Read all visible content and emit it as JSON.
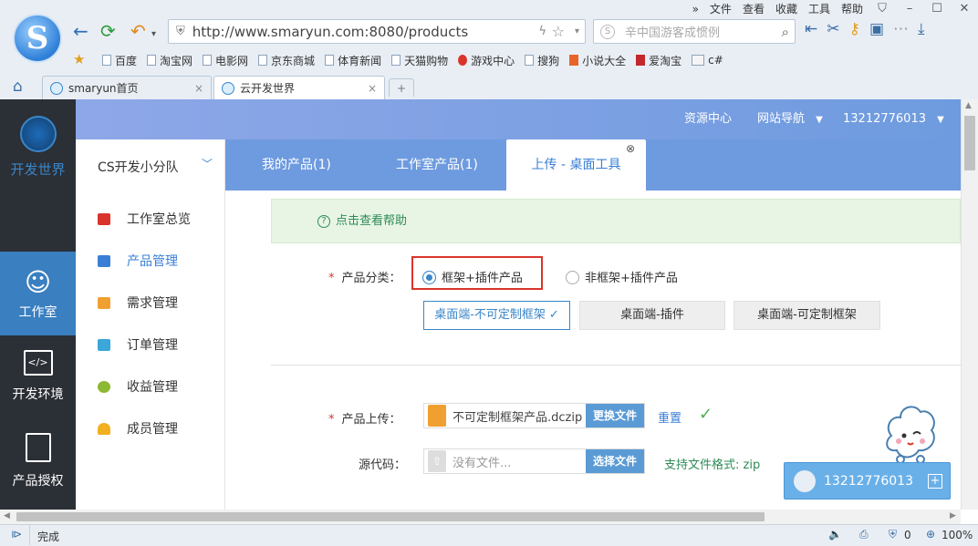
{
  "browser": {
    "menu": [
      "»",
      "文件",
      "查看",
      "收藏",
      "工具",
      "帮助"
    ],
    "url": "http://www.smaryun.com:8080/products",
    "search_placeholder": "辛中国游客成惯例",
    "logo_letter": "S",
    "bookmarks": [
      "百度",
      "淘宝网",
      "电影网",
      "京东商城",
      "体育新闻",
      "天猫购物",
      "游戏中心",
      "搜狗",
      "小说大全",
      "爱淘宝",
      "c#"
    ],
    "tabs": [
      {
        "label": "smaryun首页"
      },
      {
        "label": "云开发世界"
      }
    ],
    "tab_close": "×",
    "new_tab": "+",
    "status_text": "完成",
    "status_count": "0",
    "zoom": "100%"
  },
  "rail": {
    "brand": "开发世界",
    "items": [
      {
        "label": "工作室"
      },
      {
        "label": "开发环境"
      },
      {
        "label": "产品授权"
      }
    ]
  },
  "topbar": {
    "resource": "资源中心",
    "nav": "网站导航",
    "user": "13212776013"
  },
  "team": {
    "name": "CS开发小分队",
    "chevron": "﹀"
  },
  "sidebar": {
    "items": [
      {
        "label": "工作室总览",
        "color": "#d9342b"
      },
      {
        "label": "产品管理",
        "color": "#3a7fd5"
      },
      {
        "label": "需求管理",
        "color": "#f0a030"
      },
      {
        "label": "订单管理",
        "color": "#3aa7d8"
      },
      {
        "label": "收益管理",
        "color": "#8cb832"
      },
      {
        "label": "成员管理",
        "color": "#f0b020"
      }
    ]
  },
  "subtabs": [
    "我的产品(1)",
    "工作室产品(1)",
    "上传 - 桌面工具"
  ],
  "form": {
    "help": "点击查看帮助",
    "category_label": "产品分类：",
    "radio1": "框架+插件产品",
    "radio2": "非框架+插件产品",
    "options": [
      "桌面端-不可定制框架",
      "桌面端-插件",
      "桌面端-可定制框架"
    ],
    "upload_label": "产品上传：",
    "upload_file": "不可定制框架产品.dczip",
    "change_btn": "更换文件",
    "reset": "重置",
    "source_label": "源代码：",
    "source_placeholder": "没有文件...",
    "choose_btn": "选择文件",
    "format_hint": "支持文件格式: zip",
    "required": "*"
  },
  "chat": {
    "user": "13212776013",
    "plus": "+"
  },
  "colors": {
    "accent": "#6e9bdf",
    "rail": "#2b2f36",
    "highlight_box": "#d9342b"
  }
}
